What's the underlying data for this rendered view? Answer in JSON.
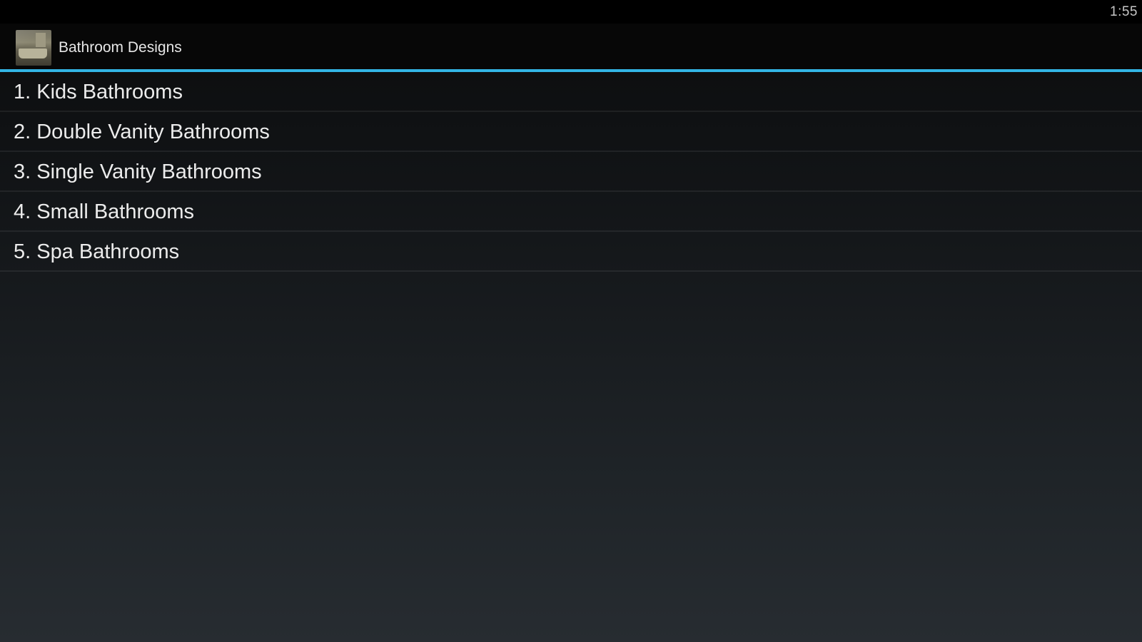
{
  "status_bar": {
    "time": "1:55"
  },
  "action_bar": {
    "title": "Bathroom Designs",
    "accent_color": "#33b5e5"
  },
  "list": {
    "items": [
      {
        "label": "1. Kids Bathrooms"
      },
      {
        "label": "2. Double Vanity Bathrooms"
      },
      {
        "label": "3. Single Vanity Bathrooms"
      },
      {
        "label": "4. Small Bathrooms"
      },
      {
        "label": "5. Spa Bathrooms"
      }
    ]
  }
}
